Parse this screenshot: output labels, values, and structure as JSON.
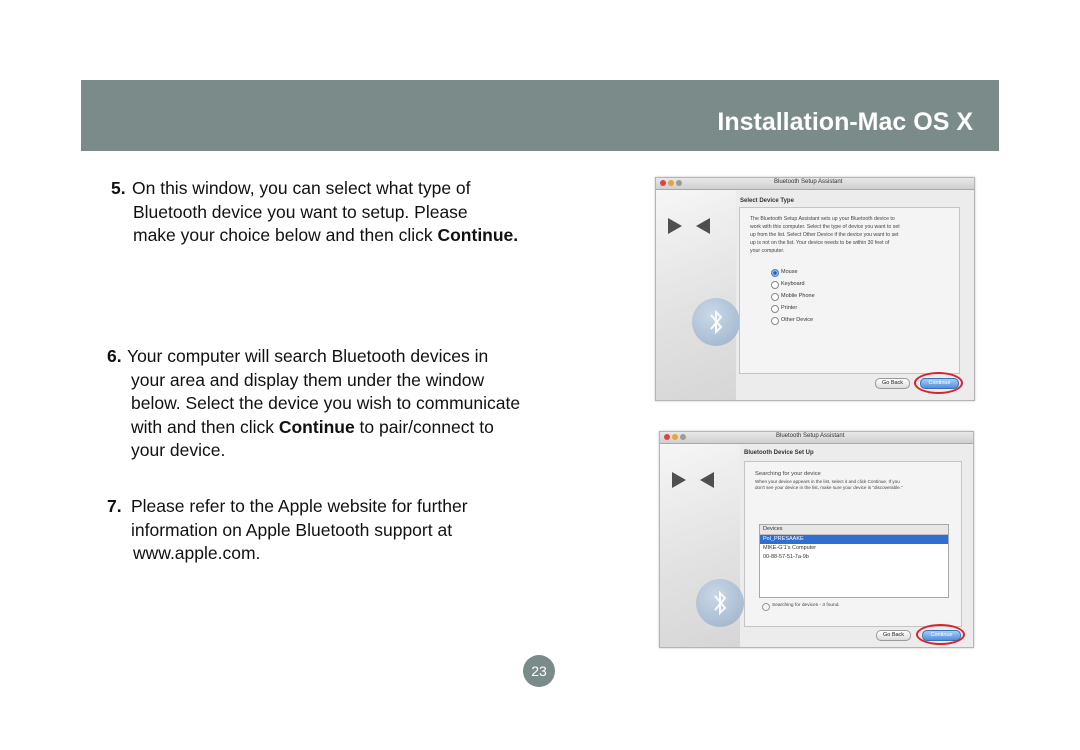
{
  "header": {
    "title": "Installation-Mac OS X"
  },
  "steps": [
    {
      "num": "5.",
      "lines": [
        "On this window, you can select what type of",
        "Bluetooth device you want to setup. Please",
        "make your choice below and then click "
      ],
      "bold": "Continue."
    },
    {
      "num": "6.",
      "lines": [
        "Your computer will search Bluetooth devices in",
        "your area and display them under the window",
        "below. Select the device you wish to communicate",
        "with and then click ",
        "your device."
      ],
      "bold": "Continue",
      "after_bold": " to pair/connect to"
    },
    {
      "num": "7.",
      "lines": [
        "Please refer to the Apple website for further",
        "information on Apple Bluetooth support at",
        "www.apple.com."
      ]
    }
  ],
  "window1": {
    "title": "Bluetooth Setup Assistant",
    "heading": "Select Device Type",
    "body": [
      "The Bluetooth Setup Assistant sets up your Bluetooth device to",
      "work with this computer. Select the type of device you want to set",
      "up from the list. Select Other Device if the device you want to set",
      "up is not on the list. Your device needs to be within 30 feet of",
      "your computer."
    ],
    "options": [
      "Mouse",
      "Keyboard",
      "Mobile Phone",
      "Printer",
      "Other Device"
    ],
    "selected": "Mouse",
    "back_label": "Go Back",
    "continue_label": "Continue"
  },
  "window2": {
    "title": "Bluetooth Setup Assistant",
    "heading": "Bluetooth Device Set Up",
    "subheading": "Searching for your device",
    "body": [
      "When your device appears in the list, select it and click Continue. If you",
      "don't see your device in the list, make sure your device is \"discoverable.\""
    ],
    "list_header": "Devices",
    "devices": [
      "Pol_PRESAAKE",
      "MIKE-G'1's Computer",
      "00-88-57-51-7a-9b"
    ],
    "status": "Searching for devices - 3 found.",
    "back_label": "Go Back",
    "continue_label": "Continue"
  },
  "page": {
    "number": "23"
  },
  "colors": {
    "header_bg": "#7b8b89",
    "highlight_ring": "#d8232a",
    "select_blue": "#2e6fd1"
  }
}
